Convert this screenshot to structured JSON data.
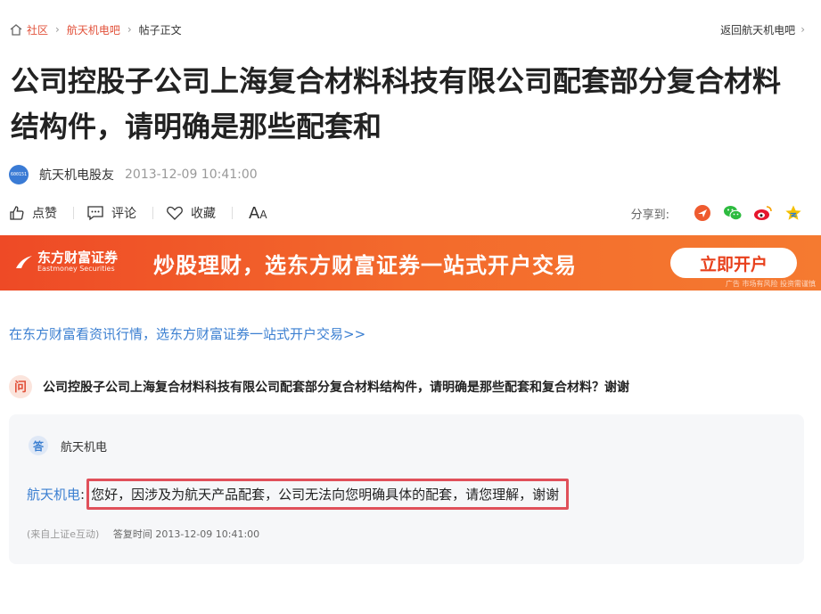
{
  "breadcrumb": {
    "items": [
      "社区",
      "航天机电吧"
    ],
    "current": "帖子正文",
    "back": "返回航天机电吧"
  },
  "post": {
    "title": "公司控股子公司上海复合材料科技有限公司配套部分复合材料结构件，请明确是那些配套和",
    "avatar_text": "600151",
    "author": "航天机电股友",
    "time": "2013-12-09 10:41:00"
  },
  "actions": {
    "like": "点赞",
    "comment": "评论",
    "favorite": "收藏",
    "font_large": "A",
    "font_small": "A",
    "share_label": "分享到:",
    "share_icons": [
      "share-tieba-icon",
      "wechat-icon",
      "weibo-icon",
      "qzone-icon"
    ]
  },
  "banner": {
    "logo_cn": "东方财富证券",
    "logo_en": "Eastmoney Securities",
    "slogan": "炒股理财，选东方财富证券一站式开户交易",
    "button": "立即开户",
    "ad_note": "广告 市场有风险 投资需谨慎"
  },
  "promo_link": "在东方财富看资讯行情，选东方财富证券一站式开户交易>>",
  "question": {
    "badge": "问",
    "text": "公司控股子公司上海复合材料科技有限公司配套部分复合材料结构件，请明确是那些配套和复合材料？谢谢"
  },
  "answer": {
    "badge": "答",
    "company": "航天机电",
    "from": "航天机电",
    "colon": ":",
    "text": "您好，因涉及为航天产品配套，公司无法向您明确具体的配套，请您理解，谢谢",
    "source": "(来自上证e互动)",
    "time_label": "答复时间 2013-12-09 10:41:00"
  },
  "colors": {
    "accent": "#e2513a",
    "link": "#3b7fd1",
    "banner": "#ee4a26",
    "highlight_border": "#e0505a"
  }
}
